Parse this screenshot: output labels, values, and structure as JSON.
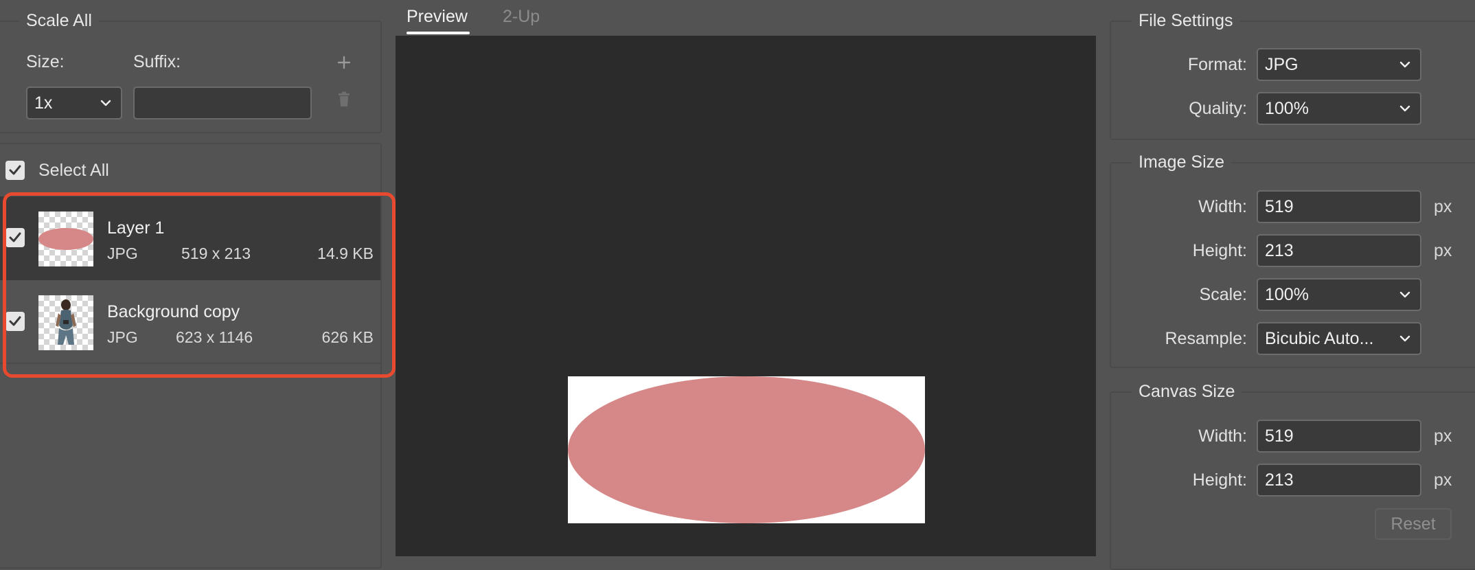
{
  "scale_all": {
    "legend": "Scale All",
    "size_label": "Size:",
    "suffix_label": "Suffix:",
    "size_value": "1x",
    "suffix_value": "",
    "add_icon": "plus-icon",
    "delete_icon": "trash-icon"
  },
  "layers": {
    "select_all_label": "Select All",
    "select_all_checked": true,
    "items": [
      {
        "name": "Layer 1",
        "format": "JPG",
        "dimensions": "519 x 213",
        "size": "14.9 KB",
        "checked": true,
        "selected": true
      },
      {
        "name": "Background copy",
        "format": "JPG",
        "dimensions": "623 x 1146",
        "size": "626 KB",
        "checked": true,
        "selected": false
      }
    ]
  },
  "tabs": [
    {
      "label": "Preview",
      "active": true
    },
    {
      "label": "2-Up",
      "active": false
    }
  ],
  "file_settings": {
    "legend": "File Settings",
    "format_label": "Format:",
    "format_value": "JPG",
    "quality_label": "Quality:",
    "quality_value": "100%"
  },
  "image_size": {
    "legend": "Image Size",
    "width_label": "Width:",
    "width_value": "519",
    "width_unit": "px",
    "height_label": "Height:",
    "height_value": "213",
    "height_unit": "px",
    "scale_label": "Scale:",
    "scale_value": "100%",
    "resample_label": "Resample:",
    "resample_value": "Bicubic Auto..."
  },
  "canvas_size": {
    "legend": "Canvas Size",
    "width_label": "Width:",
    "width_value": "519",
    "width_unit": "px",
    "height_label": "Height:",
    "height_value": "213",
    "height_unit": "px",
    "reset_label": "Reset"
  },
  "colors": {
    "panel_bg": "#535353",
    "preview_bg": "#2b2b2b",
    "ellipse_fill": "#d68788",
    "highlight": "#e84a30"
  }
}
